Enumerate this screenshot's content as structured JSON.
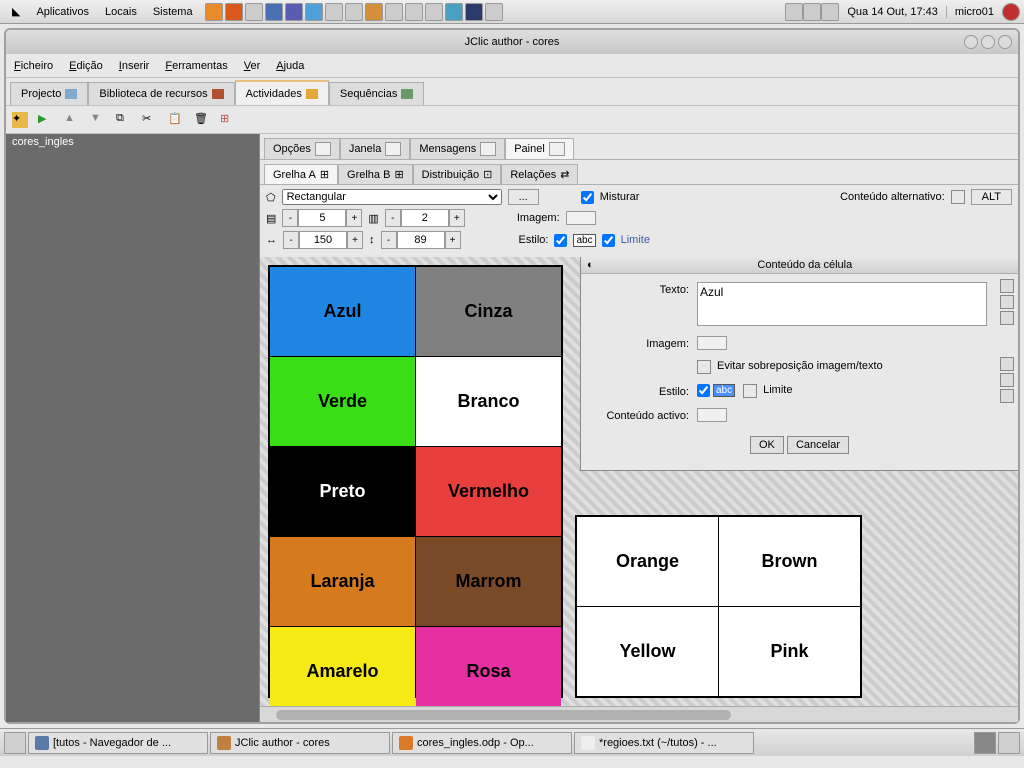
{
  "gnome": {
    "menus": [
      "Aplicativos",
      "Locais",
      "Sistema"
    ],
    "clock": "Qua 14 Out, 17:43",
    "user": "micro01"
  },
  "window": {
    "title": "JClic author - cores"
  },
  "menubar": {
    "ficheiro": "Ficheiro",
    "edicao": "Edição",
    "inserir": "Inserir",
    "ferramentas": "Ferramentas",
    "ver": "Ver",
    "ajuda": "Ajuda"
  },
  "tabs_outer": {
    "projecto": "Projecto",
    "biblioteca": "Biblioteca de recursos",
    "actividades": "Actividades",
    "sequencias": "Sequências"
  },
  "sidebar": {
    "item": "cores_ingles"
  },
  "tabs_inner": {
    "opcoes": "Opções",
    "janela": "Janela",
    "mensagens": "Mensagens",
    "painel": "Painel"
  },
  "tabs_grid": {
    "grelha_a": "Grelha A",
    "grelha_b": "Grelha B",
    "distribuicao": "Distribuição",
    "relacoes": "Relações"
  },
  "config": {
    "shape": "Rectangular",
    "misturar": "Misturar",
    "conteudo_alt": "Conteúdo alternativo:",
    "alt": "ALT",
    "cols": "5",
    "rows": "2",
    "imagem": "Imagem:",
    "w": "150",
    "h": "89",
    "estilo": "Estilo:",
    "limite": "Limite"
  },
  "grid_a": [
    {
      "label": "Azul",
      "bg": "#1e87e3",
      "fg": "#000"
    },
    {
      "label": "Cinza",
      "bg": "#808080",
      "fg": "#000"
    },
    {
      "label": "Verde",
      "bg": "#3ade17",
      "fg": "#000"
    },
    {
      "label": "Branco",
      "bg": "#ffffff",
      "fg": "#000"
    },
    {
      "label": "Preto",
      "bg": "#000000",
      "fg": "#fff"
    },
    {
      "label": "Vermelho",
      "bg": "#e93e3e",
      "fg": "#000"
    },
    {
      "label": "Laranja",
      "bg": "#d67a1e",
      "fg": "#000"
    },
    {
      "label": "Marrom",
      "bg": "#7a4a28",
      "fg": "#000"
    },
    {
      "label": "Amarelo",
      "bg": "#f5ea14",
      "fg": "#000"
    },
    {
      "label": "Rosa",
      "bg": "#e62fa0",
      "fg": "#000"
    }
  ],
  "grid_b": [
    {
      "label": "Orange"
    },
    {
      "label": "Brown"
    },
    {
      "label": "Yellow"
    },
    {
      "label": "Pink"
    }
  ],
  "dialog": {
    "title": "Conteúdo da célula",
    "texto_lbl": "Texto:",
    "texto_val": "Azul",
    "imagem_lbl": "Imagem:",
    "evitar": "Evitar sobreposição imagem/texto",
    "estilo_lbl": "Estilo:",
    "limite": "Limite",
    "activo_lbl": "Conteúdo activo:",
    "ok": "OK",
    "cancel": "Cancelar"
  },
  "taskbar": {
    "t1": "[tutos - Navegador de ...",
    "t2": "JClic author - cores",
    "t3": "cores_ingles.odp - Op...",
    "t4": "*regioes.txt (~/tutos) - ..."
  }
}
